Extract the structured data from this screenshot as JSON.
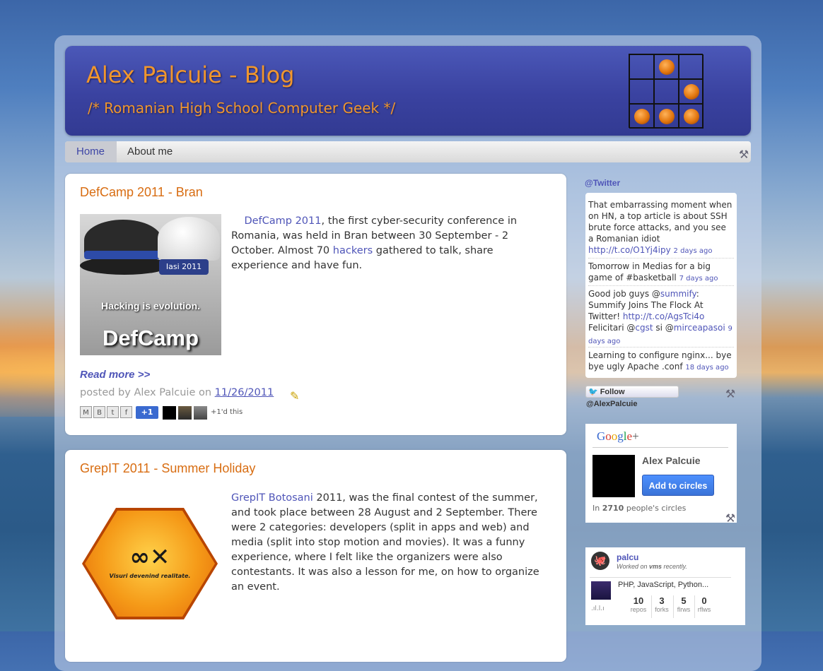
{
  "header": {
    "title": "Alex Palcuie - Blog",
    "description": "/* Romanian High School Computer Geek */"
  },
  "nav": {
    "items": [
      {
        "label": "Home",
        "active": true
      },
      {
        "label": "About me",
        "active": false
      }
    ]
  },
  "posts": [
    {
      "title": "DefCamp 2011 - Bran",
      "body_link1": "DefCamp 2011",
      "body_part1": ", the first cyber-security conference in Romania, was held in Bran between 30 September - 2 October. Almost 70 ",
      "body_link2": "hackers",
      "body_part2": " gathered to talk, share experience and have fun.",
      "image_year": "Iasi 2011",
      "image_tagline": "Hacking is evolution.",
      "image_logo": "DefCamp",
      "read_more": "Read more >>",
      "posted_prefix": "posted by Alex Palcuie on ",
      "date": "11/26/2011",
      "share_plusone": "+1",
      "plus_text": "+1'd this"
    },
    {
      "title": "GrepIT 2011 - Summer Holiday",
      "body_link1": "GrepIT Botosani",
      "body_part1": " 2011, was the final contest of the summer, and took place between 28 August and 2 September. There were 2 categories: developers (split in apps and web) and media (split into stop motion and movies). It was a funny experience, where I felt like the organizers were also contestants. It was also a lesson for me, on how to organize an event.",
      "image_tagline": "Visuri devenind realitate."
    }
  ],
  "sidebar": {
    "twitter_heading": "@Twitter",
    "tweets": [
      {
        "text": "That embarrassing moment when on HN, a top article is about SSH brute force attacks, and you see a Romanian idiot ",
        "link": "http://t.co/O1Yj4ipy",
        "ago": "2 days ago"
      },
      {
        "text": "Tomorrow in Medias for a big game of #basketball ",
        "link": "",
        "ago": "7 days ago"
      },
      {
        "text": "Good job guys @",
        "mention1": "summify",
        "text2": ": Summify Joins The Flock At Twitter! ",
        "link": "http://t.co/AgsTci4o",
        "text3": " Felicitari @",
        "mention2": "cgst",
        "text4": " si @",
        "mention3": "mirceapasoi",
        "ago": "9 days ago"
      },
      {
        "text": "Learning to configure nginx... bye bye ugly Apache .conf ",
        "link": "",
        "ago": "18 days ago"
      }
    ],
    "follow_label": "Follow @AlexPalcuie",
    "gplus": {
      "brand": "Google+",
      "name": "Alex Palcuie",
      "button": "Add to circles",
      "circles_prefix": "In ",
      "circles_count": "2710",
      "circles_suffix": " people's circles"
    },
    "github": {
      "user": "palcu",
      "worked_prefix": "Worked on ",
      "repo": "vms",
      "worked_suffix": " recently.",
      "languages": "PHP, JavaScript, Python...",
      "stats": [
        {
          "value": "10",
          "label": "repos"
        },
        {
          "value": "3",
          "label": "forks"
        },
        {
          "value": "5",
          "label": "flrws"
        },
        {
          "value": "0",
          "label": "rflws"
        }
      ]
    }
  },
  "colors": {
    "accent_orange": "#f0962e",
    "link_blue": "#4f55b8",
    "header_blue": "#3a42a0"
  }
}
